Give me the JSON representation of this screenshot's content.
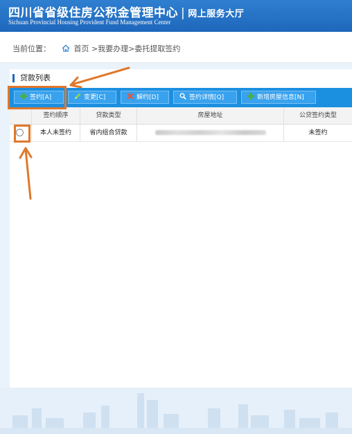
{
  "header": {
    "title": "四川省省级住房公积金管理中心",
    "separator": "|",
    "subtitle": "网上服务大厅",
    "english": "Sichuan Provincial Housing Provident Fund Management Center"
  },
  "breadcrumb": {
    "prefix": "当前位置：",
    "path": "首页 >我要办理>委托提取签约"
  },
  "section": {
    "title": "贷款列表"
  },
  "toolbar": {
    "sign": "签约[A]",
    "change": "变更[C]",
    "cancel": "解约[D]",
    "details": "签约详情[Q]",
    "add_property": "新增房屋信息[N]"
  },
  "table": {
    "headers": [
      "签约顺序",
      "贷款类型",
      "房屋地址",
      "公贷签约类型"
    ],
    "rows": [
      {
        "order": "本人未签约",
        "loan_type": "省内组合贷款",
        "address": "",
        "sign_type": "未签约"
      }
    ]
  },
  "colors": {
    "header_bg": "#1e67bc",
    "toolbar_bg": "#1b8fe0",
    "annotation": "#e0782a"
  }
}
